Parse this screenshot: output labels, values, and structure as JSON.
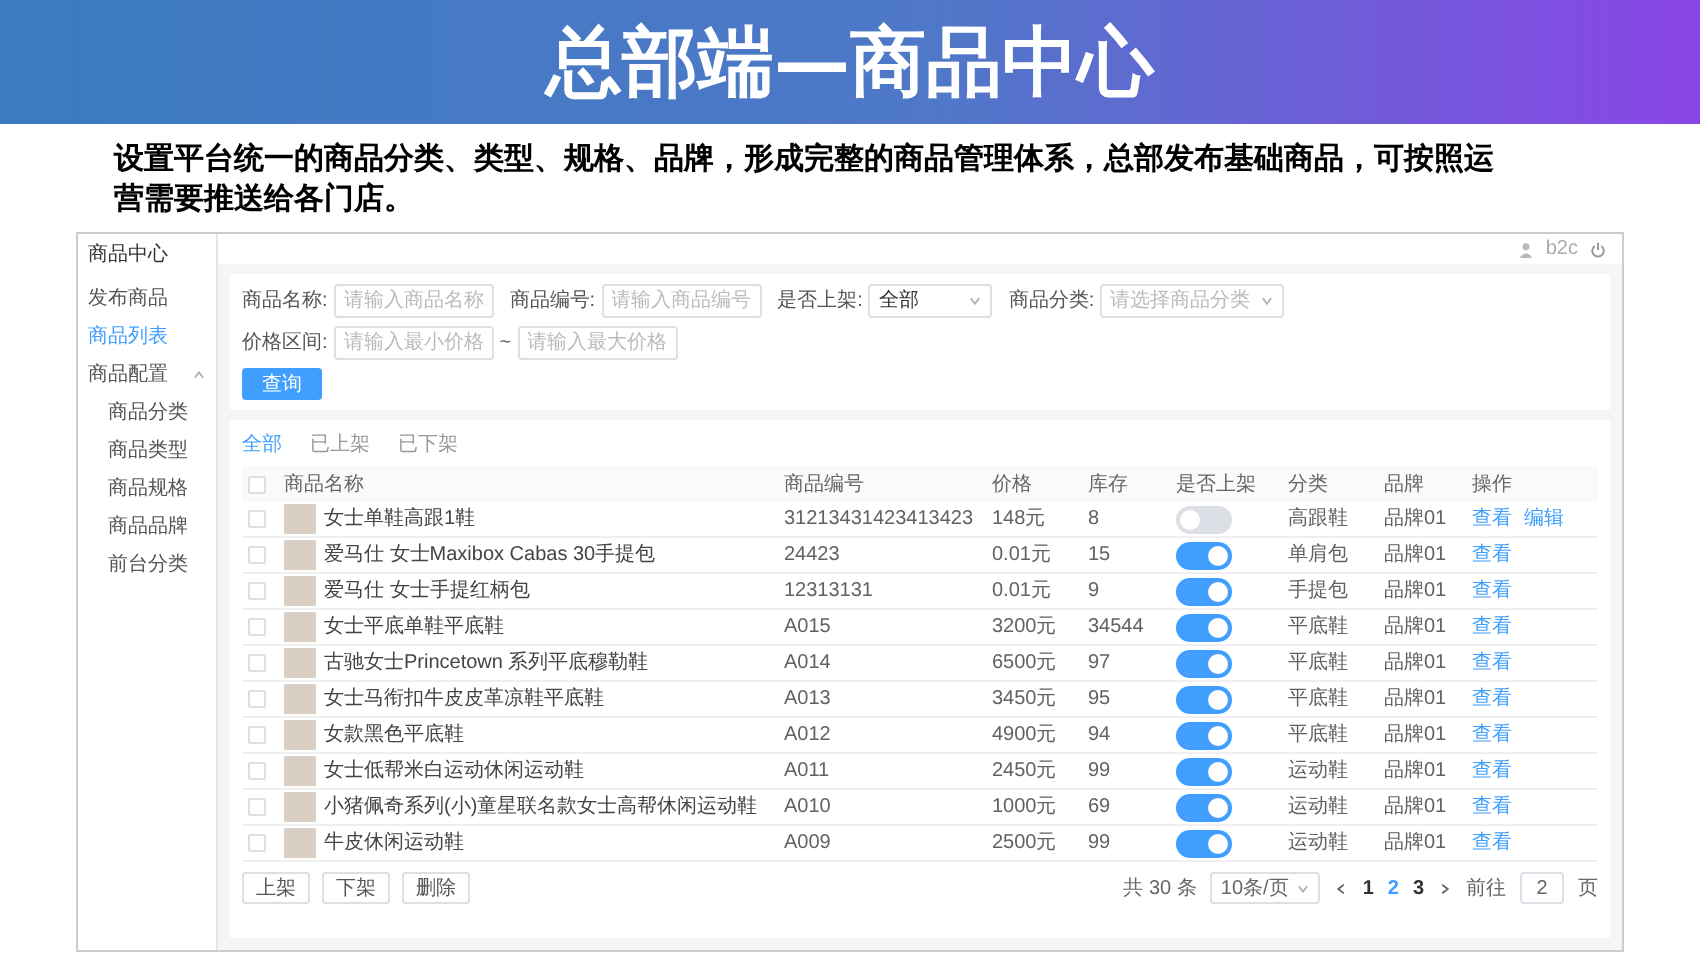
{
  "slide": {
    "title": "总部端—商品中心",
    "description": "设置平台统一的商品分类、类型、规格、品牌，形成完整的商品管理体系，总部发布基础商品，可按照运营需要推送给各门店。"
  },
  "app": {
    "sidebar": {
      "title": "商品中心",
      "items": [
        {
          "label": "发布商品",
          "selected": false
        },
        {
          "label": "商品列表",
          "selected": true
        },
        {
          "label": "商品配置",
          "selected": false,
          "expanded": true,
          "children": [
            {
              "label": "商品分类",
              "selected": false
            },
            {
              "label": "商品类型",
              "selected": false
            },
            {
              "label": "商品规格",
              "selected": false
            },
            {
              "label": "商品品牌",
              "selected": false
            },
            {
              "label": "前台分类",
              "selected": false
            }
          ]
        }
      ]
    },
    "topbar": {
      "user": "b2c"
    },
    "filters": {
      "fields": [
        {
          "kind": "input",
          "label": "商品名称:",
          "placeholder": "请输入商品名称"
        },
        {
          "kind": "input",
          "label": "商品编号:",
          "placeholder": "请输入商品编号"
        },
        {
          "kind": "select",
          "label": "是否上架:",
          "value": "全部"
        },
        {
          "kind": "select",
          "label": "商品分类:",
          "placeholder": "请选择商品分类"
        },
        {
          "kind": "range",
          "label": "价格区间:",
          "placeholder": "请输入最小价格",
          "separator": "~",
          "placeholder_2": "请输入最大价格"
        }
      ],
      "button": "查询"
    },
    "tabs": [
      {
        "label": "全部",
        "selected": true
      },
      {
        "label": "已上架",
        "selected": false
      },
      {
        "label": "已下架",
        "selected": false
      }
    ],
    "table": {
      "select_all_checked": false,
      "columns": [
        "商品名称",
        "商品编号",
        "价格",
        "库存",
        "是否上架",
        "分类",
        "品牌",
        "操作"
      ],
      "rows": [
        {
          "checked": false,
          "name": "女士单鞋高跟1鞋",
          "code": "31213431423413423",
          "price": "148元",
          "stock": "8",
          "on": false,
          "category": "高跟鞋",
          "brand": "品牌01",
          "actions": [
            "查看",
            "编辑"
          ]
        },
        {
          "checked": false,
          "name": "爱马仕 女士Maxibox Cabas 30手提包",
          "code": "24423",
          "price": "0.01元",
          "stock": "15",
          "on": true,
          "category": "单肩包",
          "brand": "品牌01",
          "actions": [
            "查看"
          ]
        },
        {
          "checked": false,
          "name": "爱马仕 女士手提红柄包",
          "code": "12313131",
          "price": "0.01元",
          "stock": "9",
          "on": true,
          "category": "手提包",
          "brand": "品牌01",
          "actions": [
            "查看"
          ]
        },
        {
          "checked": false,
          "name": "女士平底单鞋平底鞋",
          "code": "A015",
          "price": "3200元",
          "stock": "34544",
          "on": true,
          "category": "平底鞋",
          "brand": "品牌01",
          "actions": [
            "查看"
          ]
        },
        {
          "checked": false,
          "name": "古驰女士Princetown 系列平底穆勒鞋",
          "code": "A014",
          "price": "6500元",
          "stock": "97",
          "on": true,
          "category": "平底鞋",
          "brand": "品牌01",
          "actions": [
            "查看"
          ]
        },
        {
          "checked": false,
          "name": "女士马衔扣牛皮皮革凉鞋平底鞋",
          "code": "A013",
          "price": "3450元",
          "stock": "95",
          "on": true,
          "category": "平底鞋",
          "brand": "品牌01",
          "actions": [
            "查看"
          ]
        },
        {
          "checked": false,
          "name": "女款黑色平底鞋",
          "code": "A012",
          "price": "4900元",
          "stock": "94",
          "on": true,
          "category": "平底鞋",
          "brand": "品牌01",
          "actions": [
            "查看"
          ]
        },
        {
          "checked": false,
          "name": "女士低帮米白运动休闲运动鞋",
          "code": "A011",
          "price": "2450元",
          "stock": "99",
          "on": true,
          "category": "运动鞋",
          "brand": "品牌01",
          "actions": [
            "查看"
          ]
        },
        {
          "checked": false,
          "name": "小猪佩奇系列(小)童星联名款女士高帮休闲运动鞋",
          "code": "A010",
          "price": "1000元",
          "stock": "69",
          "on": true,
          "category": "运动鞋",
          "brand": "品牌01",
          "actions": [
            "查看"
          ]
        },
        {
          "checked": false,
          "name": "牛皮休闲运动鞋",
          "code": "A009",
          "price": "2500元",
          "stock": "99",
          "on": true,
          "category": "运动鞋",
          "brand": "品牌01",
          "actions": [
            "查看"
          ]
        }
      ]
    },
    "bulk_buttons": [
      "上架",
      "下架",
      "删除"
    ],
    "pagination": {
      "total": "共 30 条",
      "page_size": "10条/页",
      "pages": [
        {
          "label": "1",
          "selected": false
        },
        {
          "label": "2",
          "selected": true
        },
        {
          "label": "3",
          "selected": false
        }
      ],
      "goto_label": "前往",
      "goto_value": "2",
      "goto_suffix": "页"
    }
  }
}
